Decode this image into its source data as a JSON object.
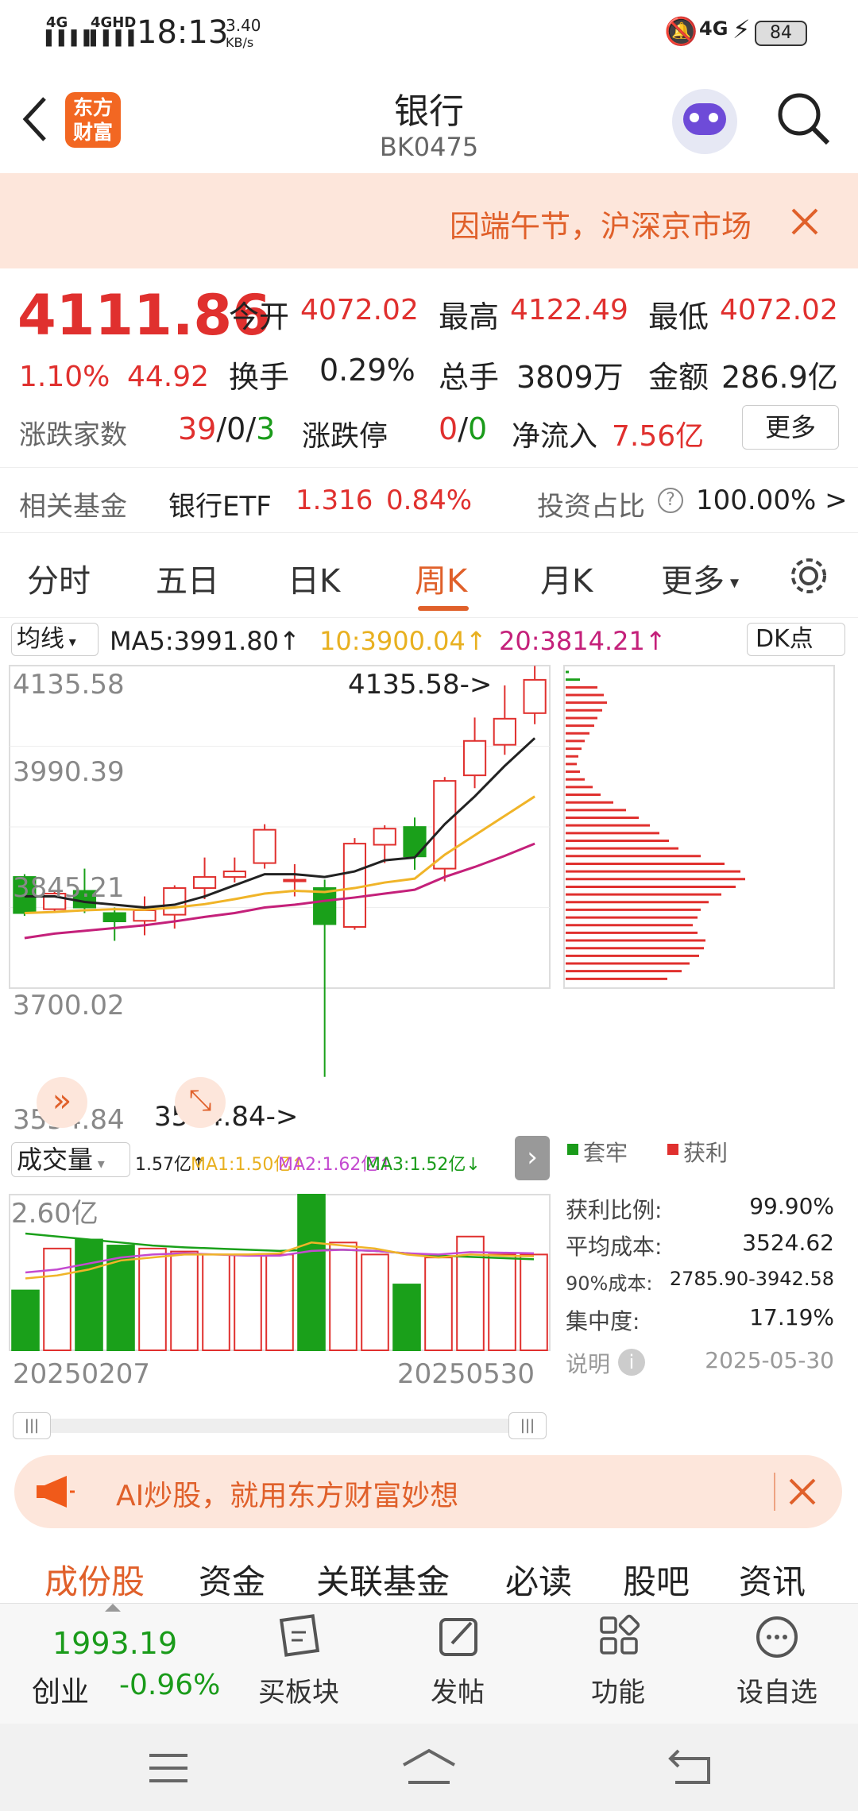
{
  "statusbar": {
    "net1": "4G",
    "net2": "4GHD",
    "time": "18:13",
    "speed_value": "3.40",
    "speed_unit": "KB/s",
    "net3": "4G",
    "battery": "84"
  },
  "header": {
    "back_icon": "chevron-left-icon",
    "logo_text": "东方财富",
    "title": "银行",
    "code": "BK0475",
    "search_icon": "search-icon",
    "assistant_icon": "robot-avatar-icon"
  },
  "notice": {
    "text": "因端午节，沪深京市场",
    "close_icon": "close-icon"
  },
  "quote": {
    "price": "4111.86",
    "change_pct": "1.10%",
    "change_abs": "44.92",
    "stats": [
      {
        "label": "今开",
        "value": "4072.02"
      },
      {
        "label": "最高",
        "value": "4122.49"
      },
      {
        "label": "最低",
        "value": "4072.02"
      },
      {
        "label": "换手",
        "value": "0.29%"
      },
      {
        "label": "总手",
        "value": "3809万"
      },
      {
        "label": "金额",
        "value": "286.9亿"
      }
    ],
    "breadth_label": "涨跌家数",
    "breadth_up": "39",
    "breadth_sep1": "/",
    "breadth_flat": "0",
    "breadth_sep2": "/",
    "breadth_down": "3",
    "limit_label": "涨跌停",
    "limit_up": "0",
    "limit_sep": "/",
    "limit_down": "0",
    "inflow_label": "净流入",
    "inflow_value": "7.56亿",
    "more_button": "更多",
    "fund_label": "相关基金",
    "fund_name": "银行ETF",
    "fund_price": "1.316",
    "fund_change": "0.84%",
    "invest_label": "投资占比",
    "invest_value": "100.00% >"
  },
  "tabs": [
    "分时",
    "五日",
    "日K",
    "周K",
    "月K",
    "更多"
  ],
  "active_tab": "周K",
  "ma_bar": {
    "selector": "均线",
    "ma5": "MA5:3991.80↑",
    "ma10": "10:3900.04↑",
    "ma20": "20:3814.21↑",
    "dk_button": "DK点"
  },
  "chart_data": {
    "type": "candlestick",
    "yticks": [
      "4135.58",
      "3990.39",
      "3845.21",
      "3700.02",
      "3554.84"
    ],
    "ylim": [
      3554.84,
      4135.58
    ],
    "max_label": "4135.58->",
    "min_label": "3554.84->",
    "candles": [
      {
        "o": 3755,
        "c": 3690,
        "h": 3760,
        "l": 3685
      },
      {
        "o": 3697,
        "c": 3725,
        "h": 3730,
        "l": 3690
      },
      {
        "o": 3730,
        "c": 3700,
        "h": 3770,
        "l": 3690
      },
      {
        "o": 3690,
        "c": 3675,
        "h": 3700,
        "l": 3640
      },
      {
        "o": 3676,
        "c": 3695,
        "h": 3720,
        "l": 3650
      },
      {
        "o": 3687,
        "c": 3735,
        "h": 3740,
        "l": 3662
      },
      {
        "o": 3735,
        "c": 3755,
        "h": 3790,
        "l": 3715
      },
      {
        "o": 3755,
        "c": 3765,
        "h": 3790,
        "l": 3745
      },
      {
        "o": 3780,
        "c": 3840,
        "h": 3850,
        "l": 3770
      },
      {
        "o": 3750,
        "c": 3750,
        "h": 3778,
        "l": 3720
      },
      {
        "o": 3735,
        "c": 3670,
        "h": 3750,
        "l": 3395
      },
      {
        "o": 3665,
        "c": 3815,
        "h": 3825,
        "l": 3660
      },
      {
        "o": 3813,
        "c": 3842,
        "h": 3848,
        "l": 3780
      },
      {
        "o": 3845,
        "c": 3792,
        "h": 3862,
        "l": 3768
      },
      {
        "o": 3770,
        "c": 3928,
        "h": 3935,
        "l": 3747
      },
      {
        "o": 3938,
        "c": 4000,
        "h": 4042,
        "l": 3915
      },
      {
        "o": 3993,
        "c": 4040,
        "h": 4100,
        "l": 3975
      },
      {
        "o": 4050,
        "c": 4110,
        "h": 4135,
        "l": 4030
      }
    ],
    "ma5": [
      3720,
      3720,
      3710,
      3705,
      3700,
      3705,
      3720,
      3740,
      3760,
      3760,
      3755,
      3765,
      3785,
      3790,
      3850,
      3900,
      3955,
      4005
    ],
    "ma10": [
      3690,
      3692,
      3695,
      3697,
      3696,
      3700,
      3706,
      3715,
      3725,
      3730,
      3728,
      3735,
      3745,
      3752,
      3795,
      3830,
      3865,
      3900
    ],
    "ma20": [
      3645,
      3653,
      3658,
      3663,
      3668,
      3675,
      3683,
      3690,
      3700,
      3705,
      3712,
      3718,
      3725,
      3732,
      3755,
      3773,
      3793,
      3815
    ],
    "chip_legend": [
      "套牢",
      "获利"
    ],
    "volume": {
      "selector": "成交量",
      "vol": "1.57亿↑",
      "ma1": "MA1:1.50亿↑",
      "ma2": "MA2:1.62亿↑",
      "ma3": "MA3:1.52亿↓",
      "ymax_label": "2.60亿",
      "ymax": 2.6,
      "bars": [
        {
          "v": 1.0,
          "up": false
        },
        {
          "v": 1.7,
          "up": true
        },
        {
          "v": 1.85,
          "up": false
        },
        {
          "v": 1.75,
          "up": false
        },
        {
          "v": 1.7,
          "up": true
        },
        {
          "v": 1.65,
          "up": true
        },
        {
          "v": 1.6,
          "up": true
        },
        {
          "v": 1.6,
          "up": true
        },
        {
          "v": 1.6,
          "up": true
        },
        {
          "v": 2.6,
          "up": false
        },
        {
          "v": 1.8,
          "up": true
        },
        {
          "v": 1.6,
          "up": true
        },
        {
          "v": 1.1,
          "up": false
        },
        {
          "v": 1.55,
          "up": true
        },
        {
          "v": 1.9,
          "up": true
        },
        {
          "v": 1.6,
          "up": true
        },
        {
          "v": 1.6,
          "up": true
        }
      ],
      "start_date": "20250207",
      "end_date": "20250530"
    }
  },
  "chip": {
    "stats": [
      {
        "label": "获利比例:",
        "value": "99.90%"
      },
      {
        "label": "平均成本:",
        "value": "3524.62"
      },
      {
        "label": "90%成本:",
        "value": "2785.90-3942.58"
      },
      {
        "label": "集中度:",
        "value": "17.19%"
      }
    ],
    "explain": "说明",
    "date": "2025-05-30"
  },
  "ad": {
    "text": "AI炒股，就用东方财富妙想",
    "icon": "megaphone-icon",
    "close_icon": "close-icon"
  },
  "subtabs": [
    "成份股",
    "资金",
    "关联基金",
    "必读",
    "股吧",
    "资讯"
  ],
  "bottomnav": {
    "index_value": "1993.19",
    "index_name": "创业",
    "index_change": "-0.96%",
    "items": [
      {
        "label": "买板块",
        "icon": "buy-sector-icon"
      },
      {
        "label": "发帖",
        "icon": "edit-post-icon"
      },
      {
        "label": "功能",
        "icon": "grid-apps-icon"
      },
      {
        "label": "设自选",
        "icon": "more-circle-icon"
      }
    ]
  }
}
